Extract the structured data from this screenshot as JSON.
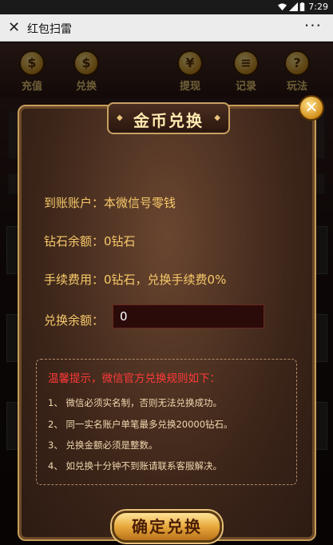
{
  "statusbar": {
    "time": "7:29"
  },
  "titlebar": {
    "close_glyph": "✕",
    "title": "红包扫雷",
    "more_glyph": "···"
  },
  "menu": [
    {
      "label": "充值",
      "icon": "coins-icon"
    },
    {
      "label": "兑换",
      "icon": "exchange-icon"
    },
    {
      "label": "提现",
      "icon": "withdraw-icon"
    },
    {
      "label": "记录",
      "icon": "record-icon"
    },
    {
      "label": "玩法",
      "icon": "help-icon"
    }
  ],
  "dialog": {
    "title": "金币兑换",
    "account_line": "到账账户：本微信号零钱",
    "balance_line": "钻石余额：0钻石",
    "fee_line": "手续费用：0钻石，兑换手续费0%",
    "amount_label": "兑换余额：",
    "amount_value": "0",
    "tips_heading": "温馨提示，微信官方兑换规则如下：",
    "tips": [
      "1、 微信必须实名制，否则无法兑换成功。",
      "2、 同一实名账户单笔最多兑换20000钻石。",
      "3、 兑换金额必须是整数。",
      "4、 如兑换十分钟不到账请联系客服解决。"
    ],
    "confirm_label": "确定兑换",
    "close_glyph": "✕"
  }
}
